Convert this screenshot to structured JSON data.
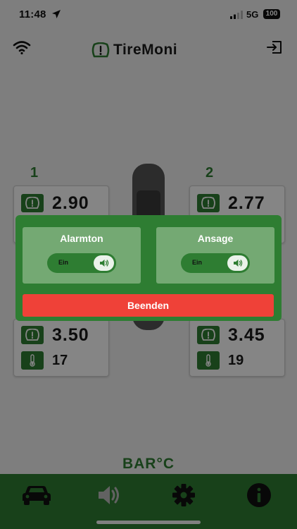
{
  "status_bar": {
    "time": "11:48",
    "network": "5G",
    "battery": "100"
  },
  "header": {
    "app_name": "TireMoni"
  },
  "tires": [
    {
      "position": "1",
      "pressure": "2.90"
    },
    {
      "position": "2",
      "pressure": "2.77"
    },
    {
      "pressure": "3.50",
      "temperature": "17"
    },
    {
      "pressure": "3.45",
      "temperature": "19"
    }
  ],
  "units": "BAR°C",
  "modal": {
    "alarm": {
      "title": "Alarmton",
      "state": "Ein"
    },
    "announce": {
      "title": "Ansage",
      "state": "Ein"
    },
    "end_label": "Beenden"
  },
  "colors": {
    "primary": "#2e7d32",
    "option_bg": "#74a973",
    "danger": "#ef4138"
  },
  "icons": [
    "location-arrow-icon",
    "signal-icon",
    "wifi-icon",
    "tire-logo-icon",
    "logout-icon",
    "tire-pressure-icon",
    "thermometer-icon",
    "speaker-icon",
    "car-icon",
    "gear-icon",
    "info-icon"
  ]
}
